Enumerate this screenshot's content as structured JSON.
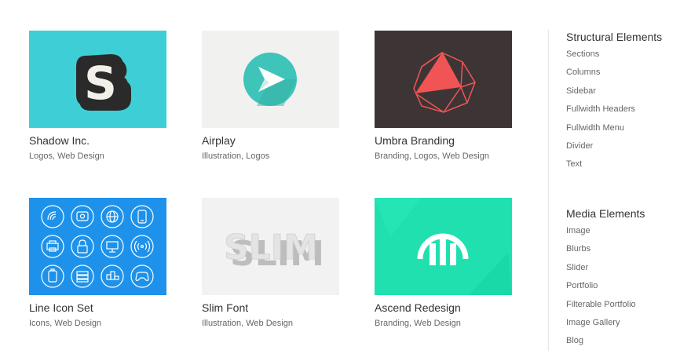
{
  "portfolio": [
    {
      "title": "Shadow Inc.",
      "meta": "Logos, Web Design",
      "bg": "#3ecfd6"
    },
    {
      "title": "Airplay",
      "meta": "Illustration, Logos",
      "bg": "#f1f1ef"
    },
    {
      "title": "Umbra Branding",
      "meta": "Branding, Logos, Web Design",
      "bg": "#3d3535"
    },
    {
      "title": "Line Icon Set",
      "meta": "Icons, Web Design",
      "bg": "#1e92ea"
    },
    {
      "title": "Slim Font",
      "meta": "Illustration, Web Design",
      "bg": "#f2f2f2"
    },
    {
      "title": "Ascend Redesign",
      "meta": "Branding, Web Design",
      "bg": "#20e0b0"
    }
  ],
  "logos": {
    "shadow_letter": "S",
    "slim_word": "SLIM"
  },
  "sidebar": {
    "structural": {
      "title": "Structural Elements",
      "items": [
        "Sections",
        "Columns",
        "Sidebar",
        "Fullwidth Headers",
        "Fullwidth Menu",
        "Divider",
        "Text"
      ]
    },
    "media": {
      "title": "Media Elements",
      "items": [
        "Image",
        "Blurbs",
        "Slider",
        "Portfolio",
        "Filterable Portfolio",
        "Image Gallery",
        "Blog"
      ]
    }
  },
  "colors": {
    "accent_red": "#f05454",
    "airplay_circle": "#3ec4b8",
    "line_icon": "#ffffff"
  }
}
